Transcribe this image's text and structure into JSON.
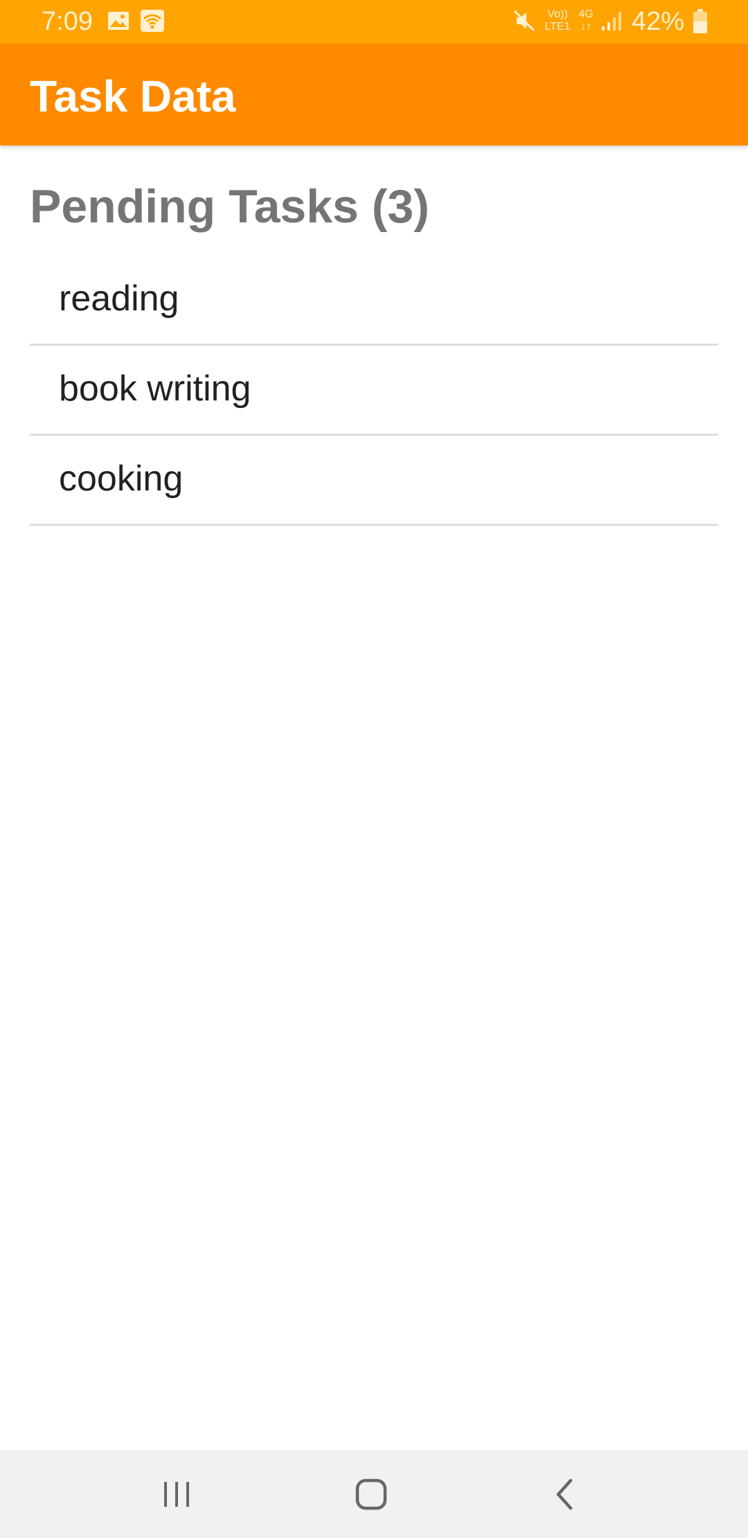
{
  "status_bar": {
    "time": "7:09",
    "battery": "42%",
    "volte": "Vo))",
    "lte": "LTE1",
    "network": "4G",
    "icons": [
      "image-icon",
      "wifi-icon",
      "mute-icon",
      "signal-icon",
      "battery-icon"
    ]
  },
  "app_bar": {
    "title": "Task Data"
  },
  "main": {
    "section_title": "Pending Tasks (3)",
    "tasks": [
      {
        "label": "reading"
      },
      {
        "label": "book writing"
      },
      {
        "label": "cooking"
      }
    ]
  },
  "nav_bar": {
    "icons": [
      "recents-icon",
      "home-icon",
      "back-icon"
    ]
  },
  "colors": {
    "status_bar": "#FFA400",
    "app_bar": "#FF8A00",
    "section_title": "#757575",
    "task_text": "#212121",
    "divider": "#DDDDDD",
    "nav_bar": "#F1F1F1"
  }
}
